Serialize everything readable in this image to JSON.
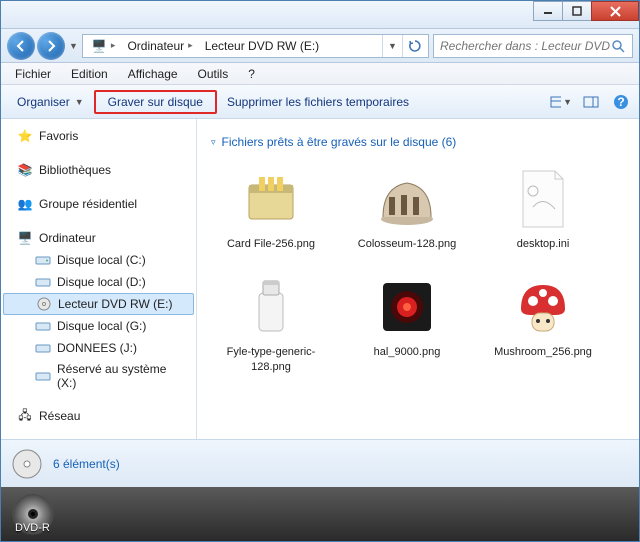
{
  "window": {},
  "breadcrumb": {
    "items": [
      "Ordinateur",
      "Lecteur DVD RW (E:)"
    ]
  },
  "search": {
    "placeholder": "Rechercher dans : Lecteur DVD R..."
  },
  "menu": {
    "file": "Fichier",
    "edit": "Edition",
    "view": "Affichage",
    "tools": "Outils",
    "help": "?"
  },
  "toolbar": {
    "organize": "Organiser",
    "burn": "Graver sur disque",
    "delete_temp": "Supprimer les fichiers temporaires"
  },
  "nav": {
    "favorites": "Favoris",
    "libraries": "Bibliothèques",
    "homegroup": "Groupe résidentiel",
    "computer": "Ordinateur",
    "drives": [
      "Disque local (C:)",
      "Disque local (D:)",
      "Lecteur DVD RW (E:)",
      "Disque local (G:)",
      "DONNEES (J:)",
      "Réservé au système (X:)"
    ],
    "network": "Réseau"
  },
  "group_header": "Fichiers prêts à être gravés sur le disque (6)",
  "files": [
    "Card File-256.png",
    "Colosseum-128.png",
    "desktop.ini",
    "Fyle-type-generic-128.png",
    "hal_9000.png",
    "Mushroom_256.png"
  ],
  "status": {
    "count": "6 élément(s)"
  },
  "footer": {
    "disc": "DVD-R"
  }
}
